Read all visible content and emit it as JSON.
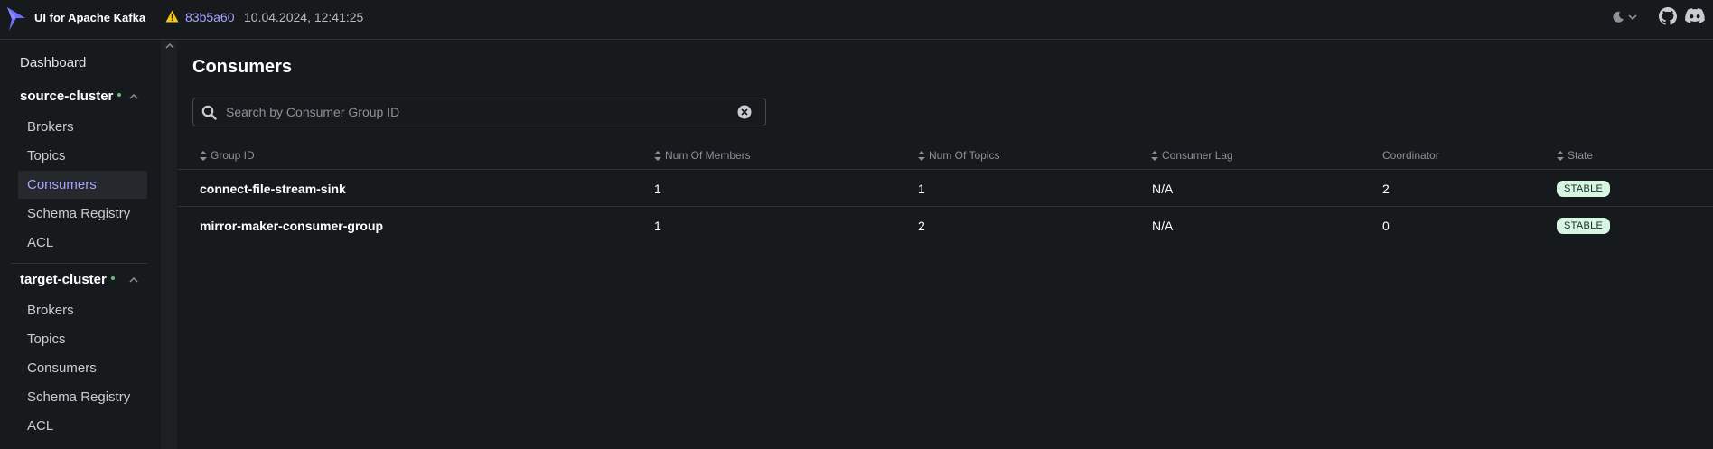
{
  "header": {
    "app_title": "UI for Apache Kafka",
    "version": "83b5a60",
    "build_date": "10.04.2024, 12:41:25",
    "accent_color": "#a8a5ff",
    "icons": [
      "logo-icon",
      "warning-icon",
      "moon-icon",
      "chevron-down-icon",
      "github-icon",
      "discord-icon"
    ]
  },
  "sidebar": {
    "dashboard": "Dashboard",
    "clusters": [
      {
        "name": "source-cluster",
        "items": [
          "Brokers",
          "Topics",
          "Consumers",
          "Schema Registry",
          "ACL"
        ],
        "active": "Consumers"
      },
      {
        "name": "target-cluster",
        "items": [
          "Brokers",
          "Topics",
          "Consumers",
          "Schema Registry",
          "ACL"
        ]
      }
    ]
  },
  "main": {
    "title": "Consumers",
    "search": {
      "placeholder": "Search by Consumer Group ID",
      "value": ""
    },
    "table": {
      "columns": [
        "Group ID",
        "Num Of Members",
        "Num Of Topics",
        "Consumer Lag",
        "Coordinator",
        "State"
      ],
      "rows": [
        {
          "group_id": "connect-file-stream-sink",
          "members": "1",
          "topics": "1",
          "lag": "N/A",
          "coordinator": "2",
          "state": "STABLE"
        },
        {
          "group_id": "mirror-maker-consumer-group",
          "members": "1",
          "topics": "2",
          "lag": "N/A",
          "coordinator": "0",
          "state": "STABLE"
        }
      ]
    }
  },
  "colors": {
    "background": "#171a1c",
    "active_link": "#a8a5ff",
    "status_dot": "#5ec27f",
    "state_badge": "#d6f5e3"
  }
}
